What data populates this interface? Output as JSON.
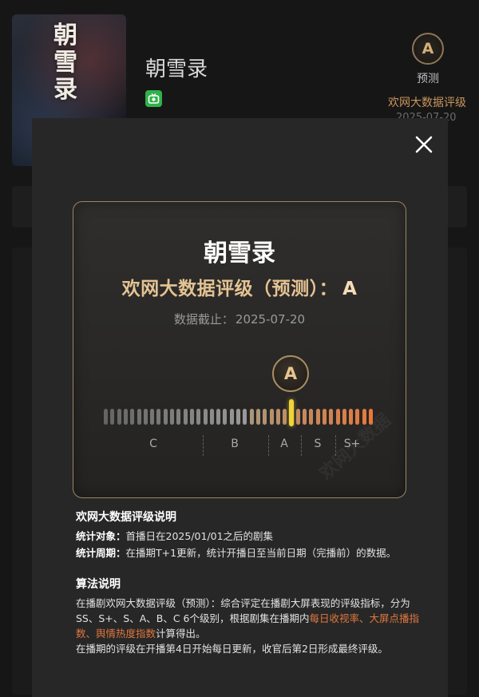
{
  "background": {
    "poster_title": "朝雪录",
    "drama_title": "朝雪录",
    "platform_icon": "video-app-icon",
    "grade": "A",
    "grade_label": "预测",
    "rating_link": "欢网大数据评级",
    "date": "2025-07-20"
  },
  "modal": {
    "close_icon": "close-icon",
    "card": {
      "title": "朝雪录",
      "rating_prefix": "欢网大数据评级（预测）：",
      "rating_grade": "A",
      "date_label": "数据截止：",
      "date_value": "2025-07-20",
      "watermark": "欢网大数据",
      "badge": "A",
      "scale_labels": [
        "C",
        "B",
        "A",
        "S",
        "S+"
      ],
      "scale_level": 0.69
    },
    "rating_section": {
      "heading": "欢网大数据评级说明",
      "object_label": "统计对象：",
      "object_text": "首播日在2025/01/01之后的剧集",
      "period_label": "统计周期：",
      "period_text": "在播期T+1更新，统计开播日至当前日期（完播前）的数据。"
    },
    "algorithm_section": {
      "heading": "算法说明",
      "para1_start": "在播剧欢网大数据评级（预测）：综合评定在播剧大屏表现的评级指标，分为SS、S+、S、A、B、C 6个级别，根据剧集在播期内",
      "para1_highlight": "每日收视率、大屏点播指数、舆情热度指数",
      "para1_end": "计算得出。",
      "para2": "在播期的评级在开播第4日开始每日更新，收官后第2日形成最终评级。"
    }
  },
  "colors": {
    "accent_gold": "#e4c394",
    "highlight_orange": "#e0783e",
    "marker_yellow": "#f0d33a"
  }
}
